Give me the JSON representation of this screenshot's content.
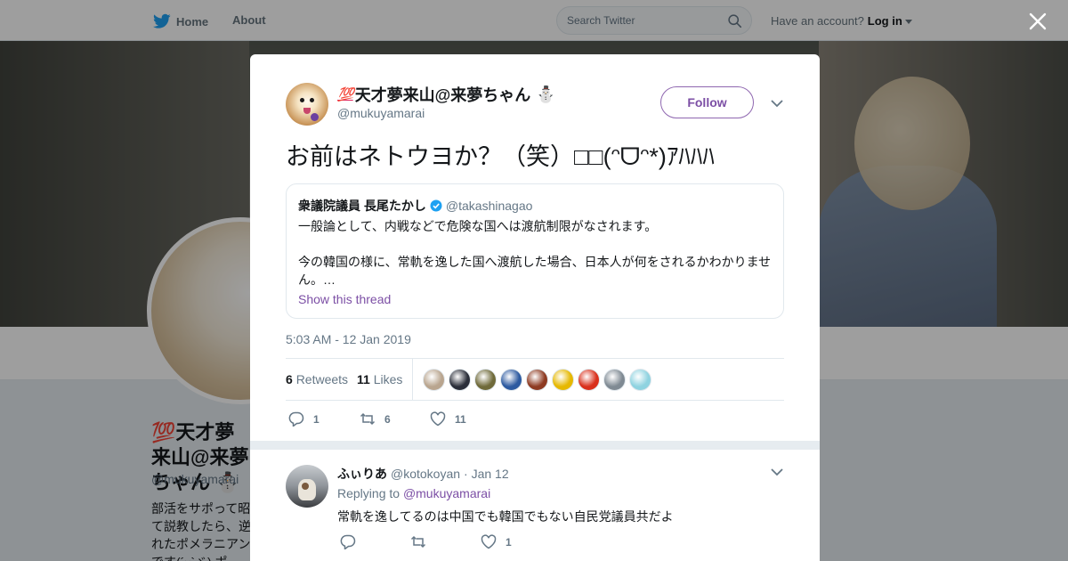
{
  "topnav": {
    "home_label": "Home",
    "about_label": "About",
    "search_placeholder": "Search Twitter",
    "account_prompt": "Have an account?",
    "login_label": "Log in"
  },
  "profile_bg": {
    "name": "💯天才夢来山@来夢ちゃん ⛄",
    "handle": "@mukuyamarai",
    "bio": "部活をサポって昭\nて説教したら、逆\nれたポメラニアン\nです(´ｰ`ゞ) ポ"
  },
  "tweet": {
    "author_name": "天才夢来山@来夢ちゃん",
    "author_badge": "💯",
    "author_snowman": "⛄",
    "author_handle": "@mukuyamarai",
    "follow_label": "Follow",
    "text": "お前はネトウヨか？（笑）□□(ᵔᗜᵔ*)ｱﾊﾊﾊ",
    "quote": {
      "name": "衆議院議員 長尾たかし",
      "handle": "@takashinagao",
      "line1": "一般論として、内戦などで危険な国へは渡航制限がなされます。",
      "line2": "今の韓国の様に、常軌を逸した国へ渡航した場合、日本人が何をされるかわかりません。…",
      "show_thread": "Show this thread"
    },
    "timestamp": "5:03 AM - 12 Jan 2019",
    "retweets_count": "6",
    "retweets_label": "Retweets",
    "likes_count": "11",
    "likes_label": "Likes",
    "liker_colors": [
      "#b9a58f",
      "#2b2f3a",
      "#6f6a3a",
      "#2d5aa0",
      "#8e3b22",
      "#e6b800",
      "#d9301c",
      "#7f8a93",
      "#8fd3e0"
    ],
    "actions": {
      "reply_count": "1",
      "retweet_count": "6",
      "like_count": "11"
    }
  },
  "reply": {
    "name": "ふぃりあ",
    "handle": "@kotokoyan",
    "date": "· Jan 12",
    "replying_prefix": "Replying to",
    "replying_to": "@mukuyamarai",
    "text": "常軌を逸してるのは中国でも韓国でもない自民党議員共だよ",
    "like_count": "1"
  },
  "colors": {
    "link": "#7c4fa5",
    "muted": "#657786",
    "overlay": "rgba(0,0,0,0.38)"
  }
}
